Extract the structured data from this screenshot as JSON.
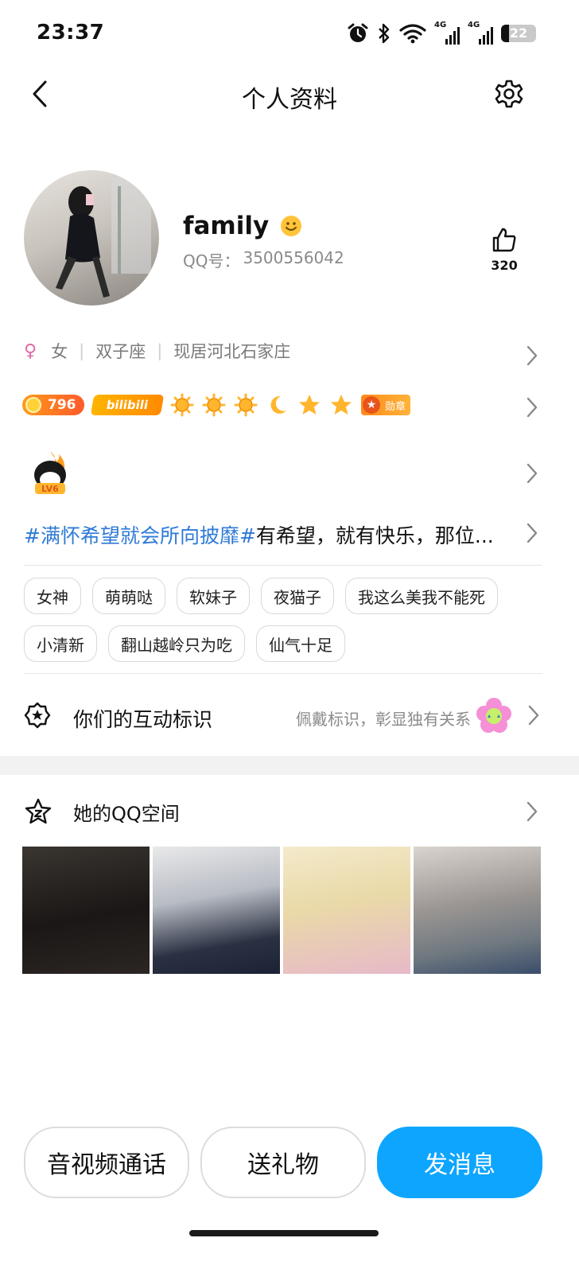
{
  "status_bar": {
    "time": "23:37",
    "net1": "4G",
    "net2": "4G",
    "battery": "22",
    "battery_level": 0.22
  },
  "nav": {
    "title": "个人资料"
  },
  "profile": {
    "name": "family",
    "qq_label": "QQ号：",
    "qq_number": "3500556042",
    "likes": "320"
  },
  "info": {
    "gender_symbol": "♀",
    "gender": "女",
    "zodiac": "双子座",
    "location": "现居河北石家庄"
  },
  "badges": {
    "qq_level": "796",
    "bili": "bilibili",
    "medal": "勋章",
    "lv": "LV6"
  },
  "signature": {
    "topic": "#满怀希望就会所向披靡#",
    "text": "有希望，就有快乐，那位..."
  },
  "tags": [
    "女神",
    "萌萌哒",
    "软妹子",
    "夜猫子",
    "我这么美我不能死",
    "小清新",
    "翻山越岭只为吃",
    "仙气十足"
  ],
  "interaction": {
    "label": "你们的互动标识",
    "hint": "佩戴标识，彰显独有关系"
  },
  "qzone": {
    "title": "她的QQ空间"
  },
  "buttons": {
    "call": "音视频通话",
    "gift": "送礼物",
    "message": "发消息"
  },
  "colors": {
    "accent": "#0ea5ff",
    "link": "#2f7ad6",
    "gender": "#e06aa6"
  }
}
